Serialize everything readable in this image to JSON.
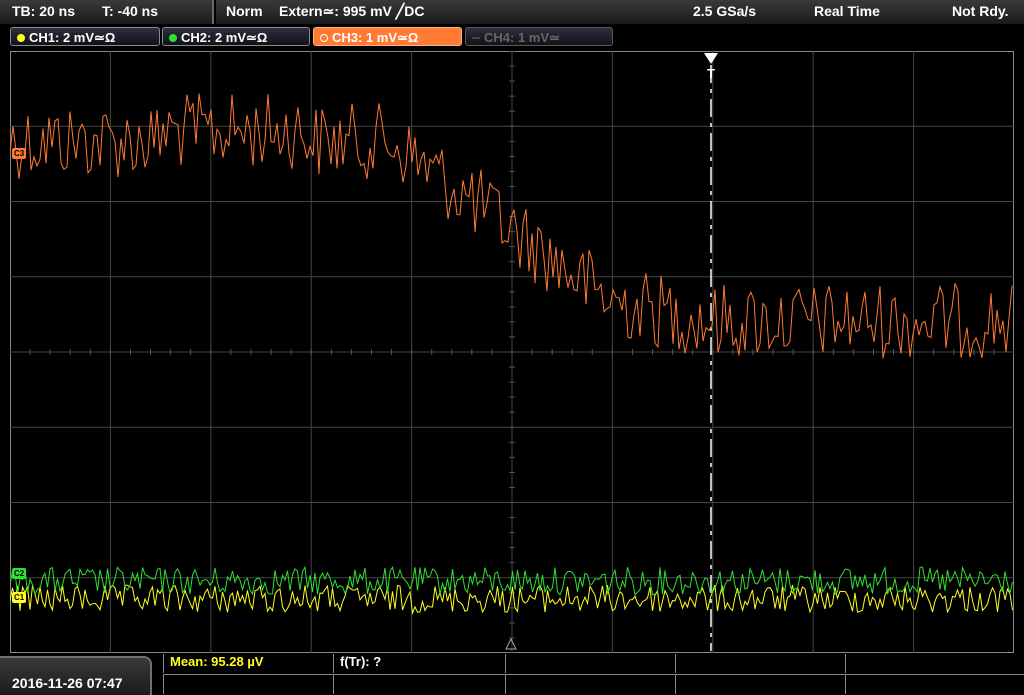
{
  "status": {
    "timebase": "TB: 20 ns",
    "trigger_time": "T: -40 ns",
    "mode": "Norm",
    "trigger_source": "Extern≃: 995 mV ╱DC",
    "sample_rate": "2.5 GSa/s",
    "acq_mode": "Real Time",
    "state": "Not Rdy."
  },
  "channels": [
    {
      "label": "CH1: 2 mV≃Ω",
      "color": "#ffff20",
      "state": "on"
    },
    {
      "label": "CH2: 2 mV≃Ω",
      "color": "#30e030",
      "state": "on"
    },
    {
      "label": "CH3: 1 mV≃Ω",
      "color": "#ff7a33",
      "state": "active"
    },
    {
      "label": "CH4: 1 mV≃",
      "color": "#666666",
      "state": "off"
    }
  ],
  "markers": {
    "ch3": "C3",
    "ch2": "C2",
    "ch1": "C1",
    "trigger": "T"
  },
  "measurements": {
    "mean": "Mean: 95.28 µV",
    "rise": "f(Tr): ?"
  },
  "datetime": "2016-11-26 07:47",
  "colors": {
    "ch1": "#ffff20",
    "ch2": "#30e030",
    "ch3": "#ff7a33",
    "grid": "#555555"
  }
}
